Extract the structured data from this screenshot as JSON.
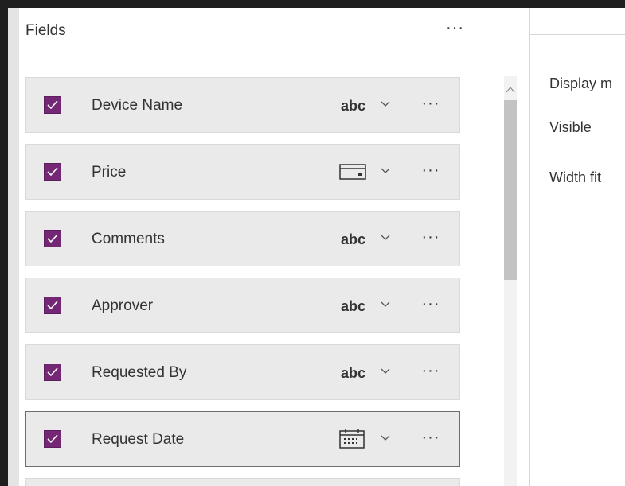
{
  "panel": {
    "title": "Fields",
    "more_label": "···"
  },
  "fields": [
    {
      "label": "Device Name",
      "type": "text",
      "type_label": "abc",
      "more_label": "···",
      "checked": true
    },
    {
      "label": "Price",
      "type": "currency",
      "type_label": "",
      "more_label": "···",
      "checked": true
    },
    {
      "label": "Comments",
      "type": "text",
      "type_label": "abc",
      "more_label": "···",
      "checked": true
    },
    {
      "label": "Approver",
      "type": "text",
      "type_label": "abc",
      "more_label": "···",
      "checked": true
    },
    {
      "label": "Requested By",
      "type": "text",
      "type_label": "abc",
      "more_label": "···",
      "checked": true
    },
    {
      "label": "Request Date",
      "type": "date",
      "type_label": "",
      "more_label": "···",
      "checked": true
    }
  ],
  "properties": {
    "display_mode": "Display m",
    "visible": "Visible",
    "width_fit": "Width fit"
  },
  "colors": {
    "accent": "#742774",
    "row_bg": "#eaeaea",
    "frame": "#1f1f1f"
  }
}
